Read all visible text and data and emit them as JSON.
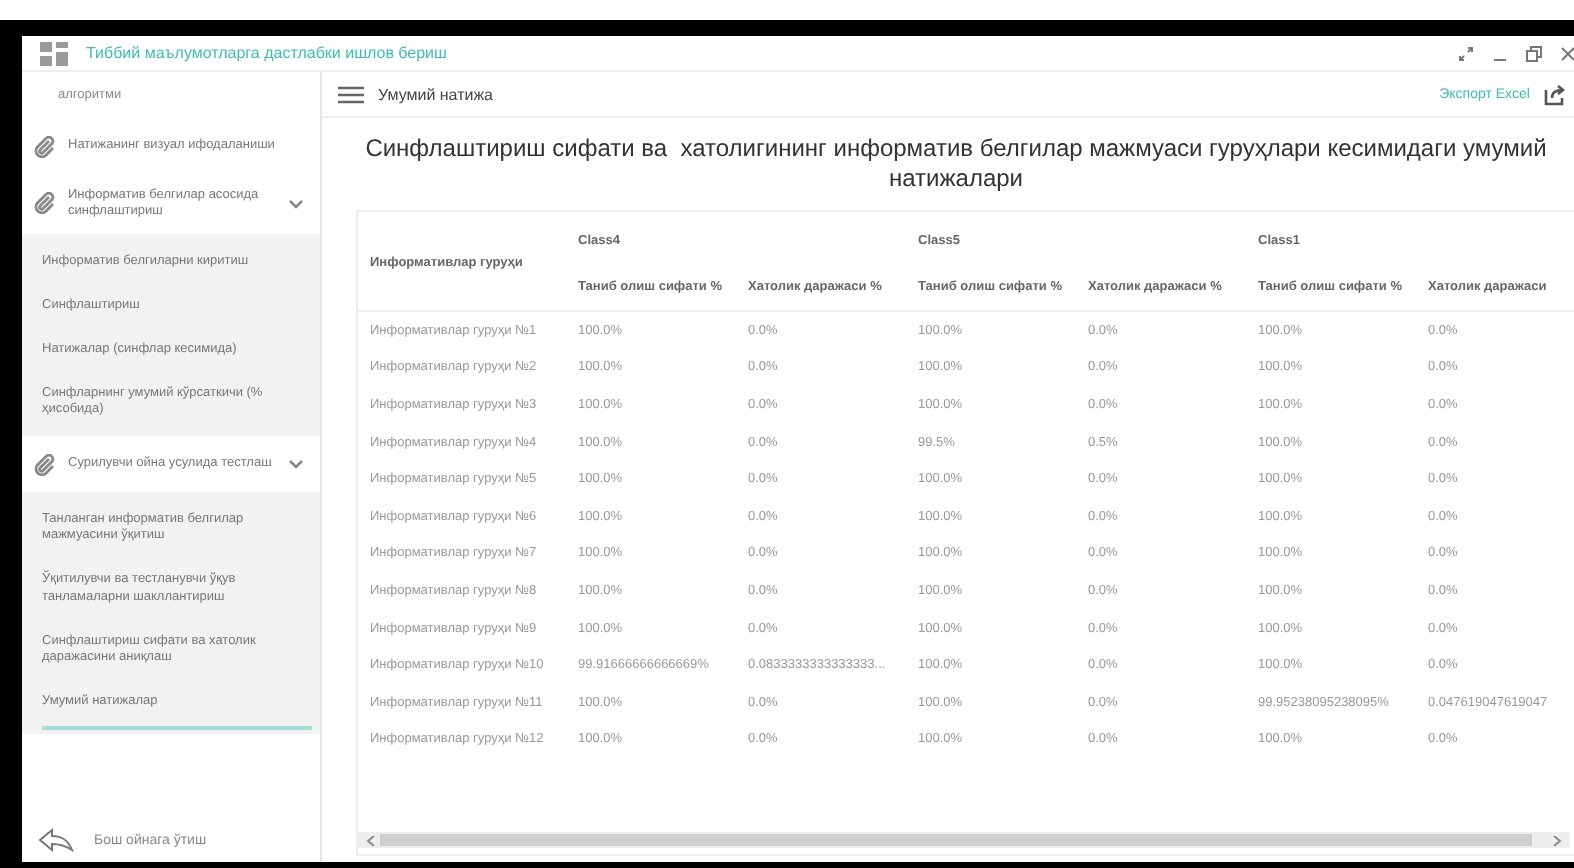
{
  "window": {
    "title": "Тиббий маълумотларга дастлабки ишлов бериш"
  },
  "sidebar": {
    "items": [
      {
        "kind": "text",
        "label": "алгоритми"
      },
      {
        "kind": "link",
        "label": "Натижанинг визуал ифодаланиши"
      },
      {
        "kind": "group",
        "label": "Информатив белгилар асосида синфлаштириш",
        "expanded": true,
        "children": [
          {
            "label": "Информатив белгиларни киритиш",
            "selected": false
          },
          {
            "label": "Синфлаштириш",
            "selected": false
          },
          {
            "label": "Натижалар (синфлар кесимида)",
            "selected": false
          },
          {
            "label": "Синфларнинг умумий кўрсаткичи (% ҳисобида)",
            "selected": false
          }
        ]
      },
      {
        "kind": "group",
        "label": "Сурилувчи ойна усулида тестлаш",
        "expanded": true,
        "children": [
          {
            "label": "Танланган информатив белгилар мажмуасини ўқитиш",
            "selected": false
          },
          {
            "label": "Ўқитилувчи ва тестланувчи ўқув танламаларни шакллантириш",
            "selected": false
          },
          {
            "label": "Синфлаштириш сифати ва хатолик даражасини аниқлаш",
            "selected": false
          },
          {
            "label": "Умумий натижалар",
            "selected": true
          }
        ]
      }
    ],
    "footer": {
      "label": "Бош ойнага ўтиш"
    }
  },
  "header": {
    "title": "Умумий натижа",
    "export": "Экспорт Excel"
  },
  "report_title": "Синфлаштириш сифати ва  хатолигининг информатив белгилар мажмуаси гуруҳлари кесимидаги умумий натижалари",
  "table": {
    "row_header": "Информативлар гуруҳи",
    "groups": [
      {
        "name": "Class4",
        "columns": [
          "Таниб олиш сифати %",
          "Хатолик даражаси %"
        ]
      },
      {
        "name": "Class5",
        "columns": [
          "Таниб олиш сифати %",
          "Хатолик даражаси %"
        ]
      },
      {
        "name": "Class1",
        "columns": [
          "Таниб олиш сифати %",
          "Хатолик даражаси"
        ]
      }
    ],
    "rows": [
      {
        "group": "Информативлар гуруҳи №1",
        "cells": [
          "100.0%",
          "0.0%",
          "100.0%",
          "0.0%",
          "100.0%",
          "0.0%"
        ]
      },
      {
        "group": "Информативлар гуруҳи №2",
        "cells": [
          "100.0%",
          "0.0%",
          "100.0%",
          "0.0%",
          "100.0%",
          "0.0%"
        ]
      },
      {
        "group": "Информативлар гуруҳи №3",
        "cells": [
          "100.0%",
          "0.0%",
          "100.0%",
          "0.0%",
          "100.0%",
          "0.0%"
        ]
      },
      {
        "group": "Информативлар гуруҳи №4",
        "cells": [
          "100.0%",
          "0.0%",
          "99.5%",
          "0.5%",
          "100.0%",
          "0.0%"
        ]
      },
      {
        "group": "Информативлар гуруҳи №5",
        "cells": [
          "100.0%",
          "0.0%",
          "100.0%",
          "0.0%",
          "100.0%",
          "0.0%"
        ]
      },
      {
        "group": "Информативлар гуруҳи №6",
        "cells": [
          "100.0%",
          "0.0%",
          "100.0%",
          "0.0%",
          "100.0%",
          "0.0%"
        ]
      },
      {
        "group": "Информативлар гуруҳи №7",
        "cells": [
          "100.0%",
          "0.0%",
          "100.0%",
          "0.0%",
          "100.0%",
          "0.0%"
        ]
      },
      {
        "group": "Информативлар гуруҳи №8",
        "cells": [
          "100.0%",
          "0.0%",
          "100.0%",
          "0.0%",
          "100.0%",
          "0.0%"
        ]
      },
      {
        "group": "Информативлар гуруҳи №9",
        "cells": [
          "100.0%",
          "0.0%",
          "100.0%",
          "0.0%",
          "100.0%",
          "0.0%"
        ]
      },
      {
        "group": "Информативлар гуруҳи №10",
        "cells": [
          "99.91666666666669%",
          "0.0833333333333333...",
          "100.0%",
          "0.0%",
          "100.0%",
          "0.0%"
        ]
      },
      {
        "group": "Информативлар гуруҳи №11",
        "cells": [
          "100.0%",
          "0.0%",
          "100.0%",
          "0.0%",
          "99.95238095238095%",
          "0.047619047619047"
        ]
      },
      {
        "group": "Информативлар гуруҳи №12",
        "cells": [
          "100.0%",
          "0.0%",
          "100.0%",
          "0.0%",
          "100.0%",
          "0.0%"
        ]
      }
    ]
  }
}
